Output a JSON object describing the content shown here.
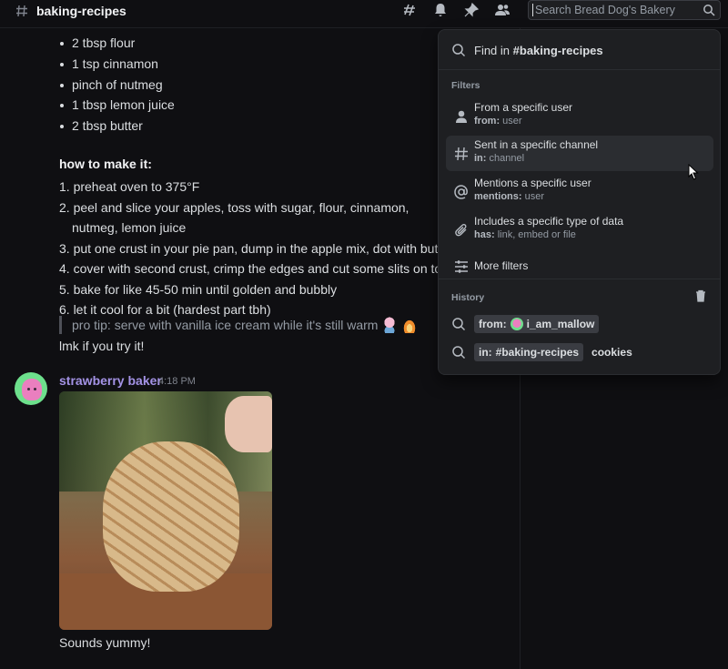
{
  "header": {
    "channel": "baking-recipes",
    "search": {
      "placeholder": "Search Bread Dog's Bakery"
    }
  },
  "message1": {
    "ingredients": [
      "2 tbsp flour",
      "1 tsp cinnamon",
      "pinch of nutmeg",
      "1 tbsp lemon juice",
      "2 tbsp butter"
    ],
    "howto_title": "how to make it:",
    "steps": [
      "1. preheat oven to 375°F",
      "2. peel and slice your apples, toss with sugar, flour, cinnamon, nutmeg, lemon juice",
      "3. put one crust in your pie pan, dump in the apple mix, dot with butter",
      "4. cover with second crust, crimp the edges and cut some slits on top",
      "5. bake for like 45-50 min until golden and bubbly",
      "6. let it cool for a bit (hardest part tbh)"
    ],
    "tip": "pro tip: serve with vanilla ice cream while it's still warm",
    "closing": "lmk if you try it!"
  },
  "message2": {
    "author": "strawberry baker",
    "time": "4:18 PM",
    "text": "Sounds yummy!"
  },
  "search_popout": {
    "find_prefix": "Find in",
    "find_channel": "#baking-recipes",
    "filters_title": "Filters",
    "filters": [
      {
        "title": "From a specific user",
        "key": "from:",
        "value": "user"
      },
      {
        "title": "Sent in a specific channel",
        "key": "in:",
        "value": "channel"
      },
      {
        "title": "Mentions a specific user",
        "key": "mentions:",
        "value": "user"
      },
      {
        "title": "Includes a specific type of data",
        "key": "has:",
        "value": "link, embed or file"
      }
    ],
    "more_filters": "More filters",
    "history_title": "History",
    "history": [
      {
        "key": "from:",
        "value": "i_am_mallow",
        "extra": ""
      },
      {
        "key": "in:",
        "value": "#baking-recipes",
        "extra": "cookies"
      }
    ]
  },
  "colors": {
    "accent_author": "#a493e6",
    "bg": "#0f0f12",
    "popout": "#1e1f22"
  }
}
